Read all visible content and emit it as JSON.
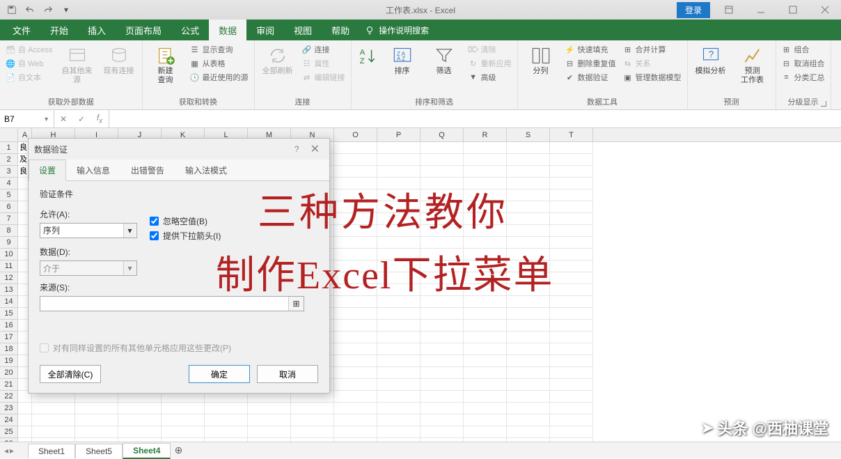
{
  "titlebar": {
    "title": "工作表.xlsx - Excel",
    "login": "登录"
  },
  "ribbonTabs": [
    "文件",
    "开始",
    "插入",
    "页面布局",
    "公式",
    "数据",
    "审阅",
    "视图",
    "帮助"
  ],
  "activeRibbonTab": "数据",
  "tellMe": "操作说明搜索",
  "ribbonGroups": {
    "external": {
      "label": "获取外部数据",
      "items": {
        "access": "自 Access",
        "web": "自 Web",
        "text": "自文本",
        "other": "自其他来源",
        "existing": "现有连接"
      }
    },
    "transform": {
      "label": "获取和转换",
      "newQuery": "新建\n查询",
      "items": {
        "show": "显示查询",
        "table": "从表格",
        "recent": "最近使用的源"
      }
    },
    "connections": {
      "label": "连接",
      "refresh": "全部刷新",
      "items": {
        "conn": "连接",
        "prop": "属性",
        "edit": "编辑链接"
      }
    },
    "sort": {
      "label": "排序和筛选",
      "sort": "排序",
      "filter": "筛选",
      "items": {
        "clear": "清除",
        "reapply": "重新应用",
        "adv": "高级"
      }
    },
    "dataTools": {
      "label": "数据工具",
      "split": "分列",
      "items": {
        "flash": "快速填充",
        "dup": "删除重复值",
        "valid": "数据验证",
        "consol": "合并计算",
        "rel": "关系",
        "model": "管理数据模型"
      }
    },
    "forecast": {
      "label": "预测",
      "analysis": "模拟分析",
      "sheet": "预测\n工作表"
    },
    "outline": {
      "label": "分级显示",
      "items": {
        "group": "组合",
        "ungroup": "取消组合",
        "subtotal": "分类汇总"
      }
    }
  },
  "nameBox": "B7",
  "columns": [
    "A",
    "H",
    "I",
    "J",
    "K",
    "L",
    "M",
    "N",
    "O",
    "P",
    "Q",
    "R",
    "S",
    "T"
  ],
  "colAData": [
    "良",
    "及",
    "良"
  ],
  "dialog": {
    "title": "数据验证",
    "tabs": [
      "设置",
      "输入信息",
      "出错警告",
      "输入法模式"
    ],
    "section": "验证条件",
    "allowLabel": "允许(A):",
    "allowValue": "序列",
    "ignoreBlank": "忽略空值(B)",
    "dropdown": "提供下拉箭头(I)",
    "dataLabel": "数据(D):",
    "dataValue": "介于",
    "sourceLabel": "来源(S):",
    "applyOthers": "对有同样设置的所有其他单元格应用这些更改(P)",
    "clearAll": "全部清除(C)",
    "ok": "确定",
    "cancel": "取消"
  },
  "overlay": {
    "line1": "三种方法教你",
    "line2": "制作Excel下拉菜单"
  },
  "watermark": "头条 @西柚课堂",
  "sheets": [
    "Sheet1",
    "Sheet5",
    "Sheet4"
  ],
  "activeSheet": "Sheet4"
}
